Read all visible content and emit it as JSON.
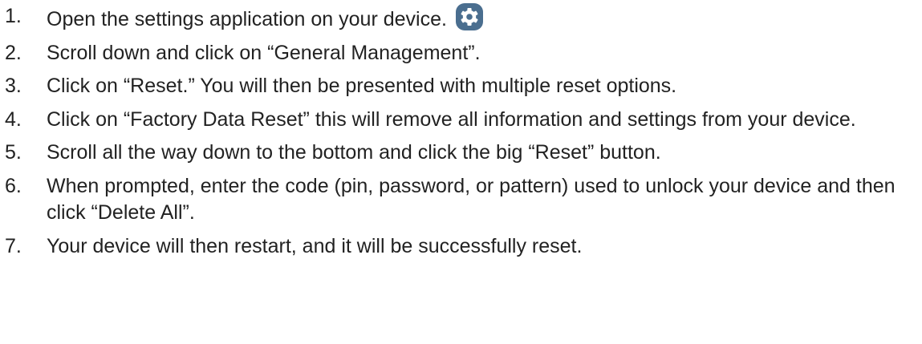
{
  "steps": [
    {
      "number": "1.",
      "text": "Open the settings application on your device."
    },
    {
      "number": "2.",
      "text": "Scroll down and click on “General Management”."
    },
    {
      "number": "3.",
      "text": "Click on “Reset.” You will then be presented with multiple reset options."
    },
    {
      "number": "4.",
      "text": "Click on “Factory Data Reset” this will remove all information and settings from your device."
    },
    {
      "number": "5.",
      "text": "Scroll all the way down to the bottom and click the big “Reset” button."
    },
    {
      "number": "6.",
      "text": "When prompted, enter the code (pin, password, or pattern) used to unlock your device and then click “Delete All”."
    },
    {
      "number": "7.",
      "text": "Your device will then restart, and it will be successfully reset."
    }
  ],
  "icons": {
    "settings": "gear-icon"
  },
  "colors": {
    "text": "#222222",
    "icon_background": "#4a6e8f",
    "icon_foreground": "#ffffff"
  }
}
